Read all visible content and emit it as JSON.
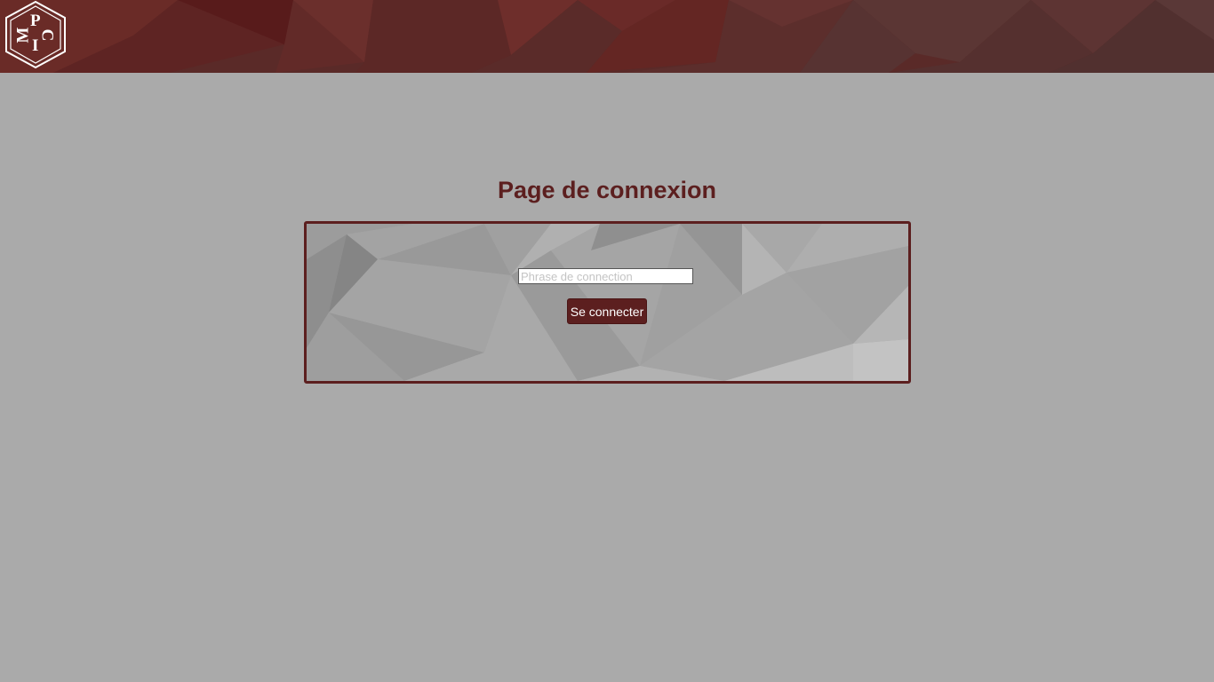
{
  "header": {
    "logo": {
      "letters": [
        "M",
        "P",
        "C",
        "I"
      ],
      "icon": "mpci-hexagon-logo"
    }
  },
  "page": {
    "title": "Page de connexion"
  },
  "login": {
    "passphrase_placeholder": "Phrase de connection",
    "passphrase_value": "",
    "submit_label": "Se connecter"
  },
  "colors": {
    "page_background": "#aaaaaa",
    "header_background": "#5a2a28",
    "accent": "#5c1f1f",
    "button_text": "#ffffff"
  }
}
